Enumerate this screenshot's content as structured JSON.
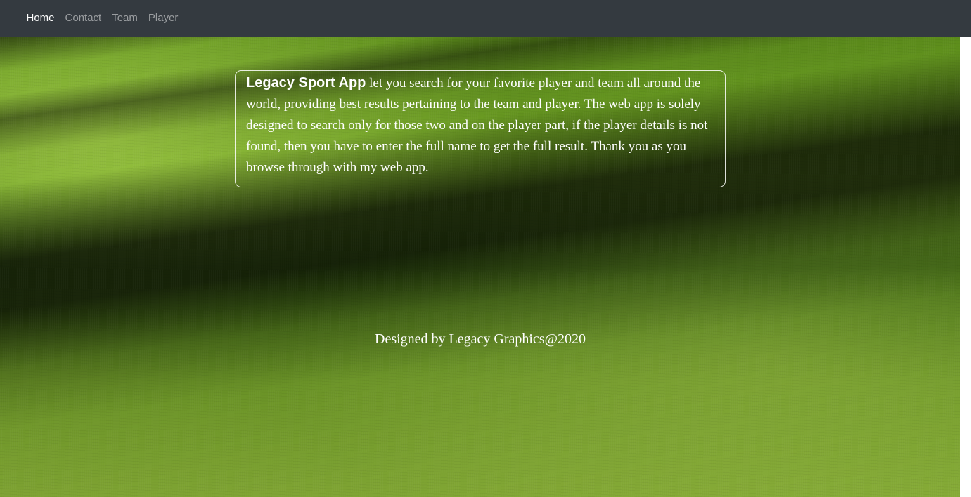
{
  "nav": {
    "items": [
      {
        "label": "Home",
        "active": true
      },
      {
        "label": "Contact",
        "active": false
      },
      {
        "label": "Team",
        "active": false
      },
      {
        "label": "Player",
        "active": false
      }
    ]
  },
  "intro": {
    "brand": "Legacy Sport App",
    "text": " let you search for your favorite player and team all around the world, providing best results pertaining to the team and player. The web app is solely designed to search only for those two and on the player part, if the player details is not found, then you have to enter the full name to get the full result. Thank you as you browse through with my web app."
  },
  "footer": {
    "credit": "Designed by Legacy Graphics@2020"
  },
  "colors": {
    "navbar_bg": "#343a40",
    "nav_active": "#ffffff",
    "nav_inactive": "rgba(255,255,255,0.5)",
    "text": "#ffffff"
  }
}
